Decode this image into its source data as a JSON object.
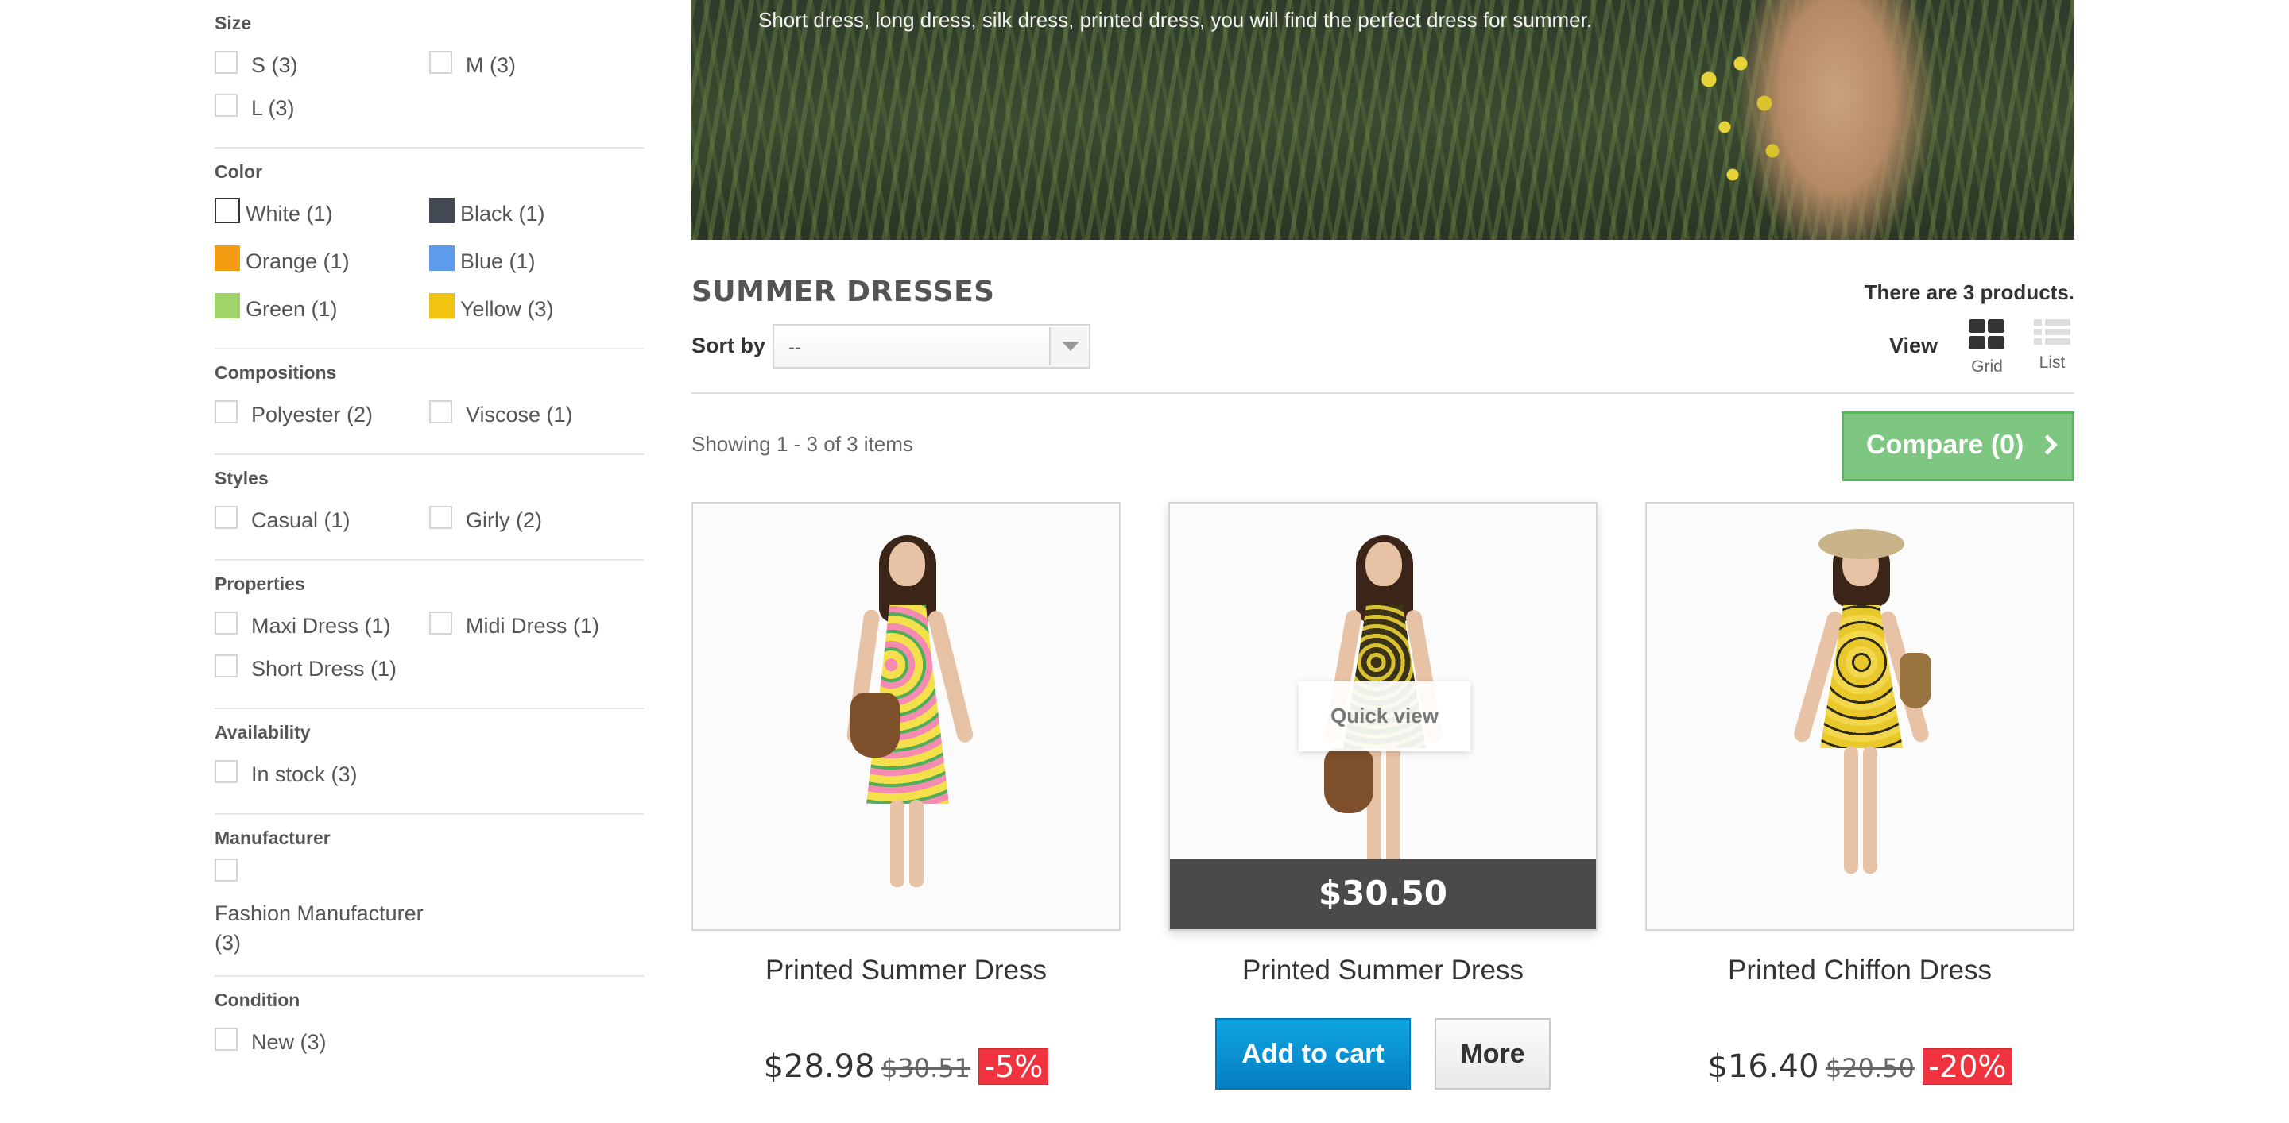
{
  "filters": {
    "size": {
      "title": "Size",
      "items": [
        "S (3)",
        "M (3)",
        "L (3)"
      ]
    },
    "color": {
      "title": "Color",
      "items": [
        {
          "label": "White (1)",
          "color": "#ffffff"
        },
        {
          "label": "Black (1)",
          "color": "#434a54"
        },
        {
          "label": "Orange (1)",
          "color": "#f39c11"
        },
        {
          "label": "Blue (1)",
          "color": "#5d9cec"
        },
        {
          "label": "Green (1)",
          "color": "#a0d468"
        },
        {
          "label": "Yellow (3)",
          "color": "#f1c40f"
        }
      ]
    },
    "compositions": {
      "title": "Compositions",
      "items": [
        "Polyester (2)",
        "Viscose (1)"
      ]
    },
    "styles": {
      "title": "Styles",
      "items": [
        "Casual (1)",
        "Girly (2)"
      ]
    },
    "properties": {
      "title": "Properties",
      "items": [
        "Maxi Dress (1)",
        "Midi Dress (1)",
        "Short Dress (1)"
      ]
    },
    "availability": {
      "title": "Availability",
      "items": [
        "In stock (3)"
      ]
    },
    "manufacturer": {
      "title": "Manufacturer",
      "items": [
        "Fashion Manufacturer (3)"
      ]
    },
    "condition": {
      "title": "Condition",
      "items": [
        "New (3)"
      ]
    }
  },
  "banner": {
    "text": "Short dress, long dress, silk dress, printed dress, you will find the perfect dress for summer."
  },
  "category": {
    "title": "SUMMER DRESSES",
    "count_text": "There are 3 products."
  },
  "toolbar": {
    "sort_label": "Sort by",
    "sort_value": "--",
    "view_label": "View",
    "grid_label": "Grid",
    "list_label": "List"
  },
  "results": {
    "showing": "Showing 1 - 3 of 3 items",
    "compare_label": "Compare (0)"
  },
  "products": [
    {
      "name": "Printed Summer Dress",
      "price": "$28.98",
      "old_price": "$30.51",
      "reduction": "-5%",
      "dress_color": "#f3e04a"
    },
    {
      "name": "Printed Summer Dress",
      "price_overlay": "$30.50",
      "quick_view": "Quick view",
      "add_to_cart": "Add to cart",
      "more": "More",
      "dress_color": "#3a3318"
    },
    {
      "name": "Printed Chiffon Dress",
      "price": "$16.40",
      "old_price": "$20.50",
      "reduction": "-20%",
      "dress_color": "#e8c82a"
    }
  ],
  "colors": {
    "accent_blue": "#047ec2",
    "compare_green": "#7dc780",
    "sale_red": "#f13340"
  }
}
